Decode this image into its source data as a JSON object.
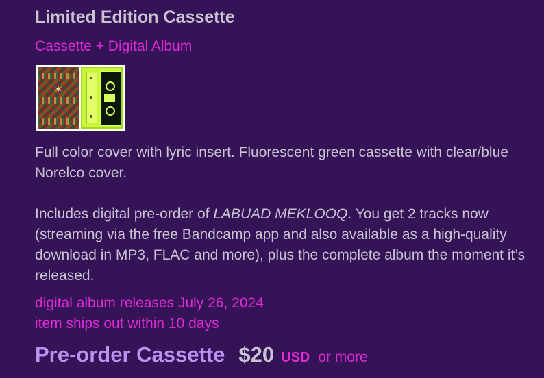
{
  "package": {
    "title": "Limited Edition Cassette",
    "format_link": "Cassette + Digital Album"
  },
  "thumbnail": {
    "icon": "cassette-package-thumbnail"
  },
  "description": {
    "paragraph1": "Full color cover with lyric insert. Fluorescent green cassette with clear/blue Norelco cover.",
    "paragraph2_pre": "Includes digital pre-order of ",
    "paragraph2_album": "LABUAD MEKLOOQ",
    "paragraph2_post": ". You get 2 tracks now (streaming via the free Bandcamp app and also available as a high-quality download in MP3, FLAC and more), plus the complete album the moment it’s released."
  },
  "release": {
    "date_text": "digital album releases July 26, 2024",
    "ships_text": "item ships out within 10 days"
  },
  "buy": {
    "label": "Pre-order Cassette",
    "price": "$20",
    "currency": "USD",
    "or_more": "or more"
  },
  "colors": {
    "background": "#341457",
    "text": "#c9c2d2",
    "link": "#e02ad6",
    "buy_label": "#b993f0"
  }
}
